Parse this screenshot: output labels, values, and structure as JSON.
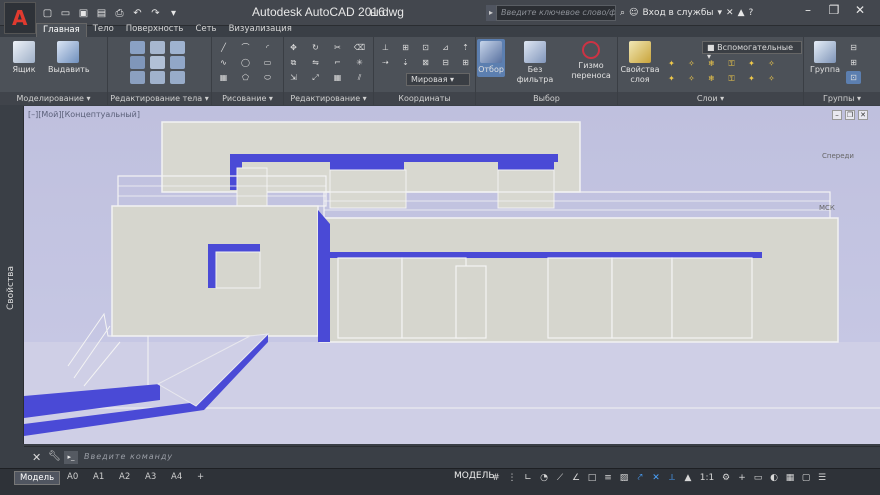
{
  "app": {
    "title": "Autodesk AutoCAD 2016",
    "document": "ы.dwg",
    "logo_letter": "A"
  },
  "search": {
    "placeholder": "Введите ключевое слово/фразу"
  },
  "account": {
    "signin_label": "Вход в службы"
  },
  "ribbon_tabs": [
    "Главная",
    "Тело",
    "Поверхность",
    "Сеть",
    "Визуализация"
  ],
  "panels": {
    "modeling": {
      "title": "Моделирование ▾",
      "box_label": "Ящик",
      "extrude_label": "Выдавить"
    },
    "solid_editing": {
      "title": "Редактирование тела ▾"
    },
    "draw": {
      "title": "Рисование ▾"
    },
    "modify": {
      "title": "Редактирование ▾"
    },
    "coordinates": {
      "title": "Координаты",
      "combo_value": "Мировая"
    },
    "selection": {
      "title": "Выбор",
      "culling_label": "Отбор",
      "filter_label": "Без фильтра",
      "gizmo_label": "Гизмо переноса"
    },
    "layers": {
      "title": "Слои ▾",
      "props_label": "Свойства слоя",
      "layer_value": "Вспомогательные"
    },
    "groups": {
      "title": "Группы ▾",
      "group_label": "Группа"
    }
  },
  "viewport": {
    "label": "[–][Мой][Концептуальный]",
    "viewcube_label": "Спереди",
    "ucs_label": "МСК"
  },
  "sidebar": {
    "properties_label": "Свойства"
  },
  "command": {
    "placeholder": "Введите команду"
  },
  "layouts": [
    "Модель",
    "A0",
    "A1",
    "A2",
    "A3",
    "A4"
  ],
  "status": {
    "model_label": "МОДЕЛЬ",
    "scale": "1:1"
  },
  "colors": {
    "accent_blue": "#4a4ad6",
    "viewport_bg": "#c3c4e2",
    "ribbon_bg": "#4c5158"
  }
}
